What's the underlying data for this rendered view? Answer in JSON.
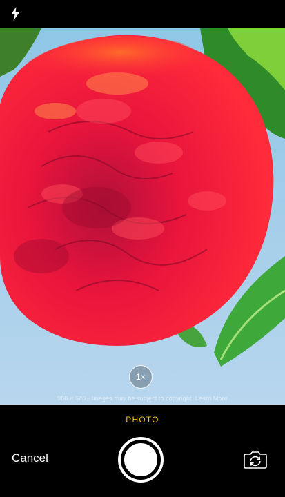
{
  "top_bar": {
    "flash_icon": "flash-icon"
  },
  "viewfinder": {
    "subject": "red peony flower",
    "watermark": "960 × 640 - Images may be subject to copyright. Learn More",
    "zoom_label": "1×"
  },
  "controls": {
    "mode_label": "PHOTO",
    "cancel_label": "Cancel",
    "shutter_icon": "shutter-button",
    "switch_icon": "camera-switch-icon"
  },
  "colors": {
    "mode_accent": "#f5c518",
    "background": "#000000"
  }
}
